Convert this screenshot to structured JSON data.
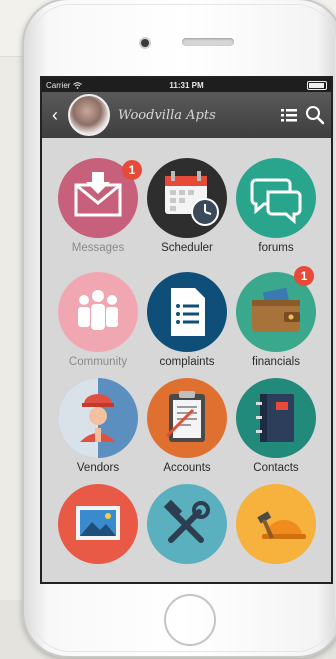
{
  "status_bar": {
    "carrier": "Carrier",
    "time": "11:31 PM"
  },
  "nav": {
    "title": "Woodvilla Apts",
    "back_icon": "chevron-left-icon",
    "list_icon": "list-icon",
    "search_icon": "search-icon"
  },
  "tiles": [
    {
      "label": "Messages",
      "color": "#c7607a",
      "icon": "envelope-icon",
      "badge": "1"
    },
    {
      "label": "Scheduler",
      "color": "#2e2e2e",
      "icon": "calendar-clock-icon",
      "badge": ""
    },
    {
      "label": "forums",
      "color": "#2aa58d",
      "icon": "chat-bubbles-icon",
      "badge": ""
    },
    {
      "label": "Community",
      "color": "#f1a7b2",
      "icon": "people-icon",
      "badge": ""
    },
    {
      "label": "complaints",
      "color": "#0e4e78",
      "icon": "document-list-icon",
      "badge": ""
    },
    {
      "label": "financials",
      "color": "#3aa88c",
      "icon": "wallet-icon",
      "badge": "1"
    },
    {
      "label": "Vendors",
      "color": "#5b8fc0",
      "icon": "worker-icon",
      "badge": ""
    },
    {
      "label": "Accounts",
      "color": "#e07030",
      "icon": "clipboard-icon",
      "badge": ""
    },
    {
      "label": "Contacts",
      "color": "#218a7a",
      "icon": "address-book-icon",
      "badge": ""
    },
    {
      "label": "",
      "color": "#e85a45",
      "icon": "picture-icon",
      "badge": ""
    },
    {
      "label": "",
      "color": "#5ab0bf",
      "icon": "tools-icon",
      "badge": ""
    },
    {
      "label": "",
      "color": "#f6b23c",
      "icon": "hardhat-icon",
      "badge": ""
    }
  ]
}
